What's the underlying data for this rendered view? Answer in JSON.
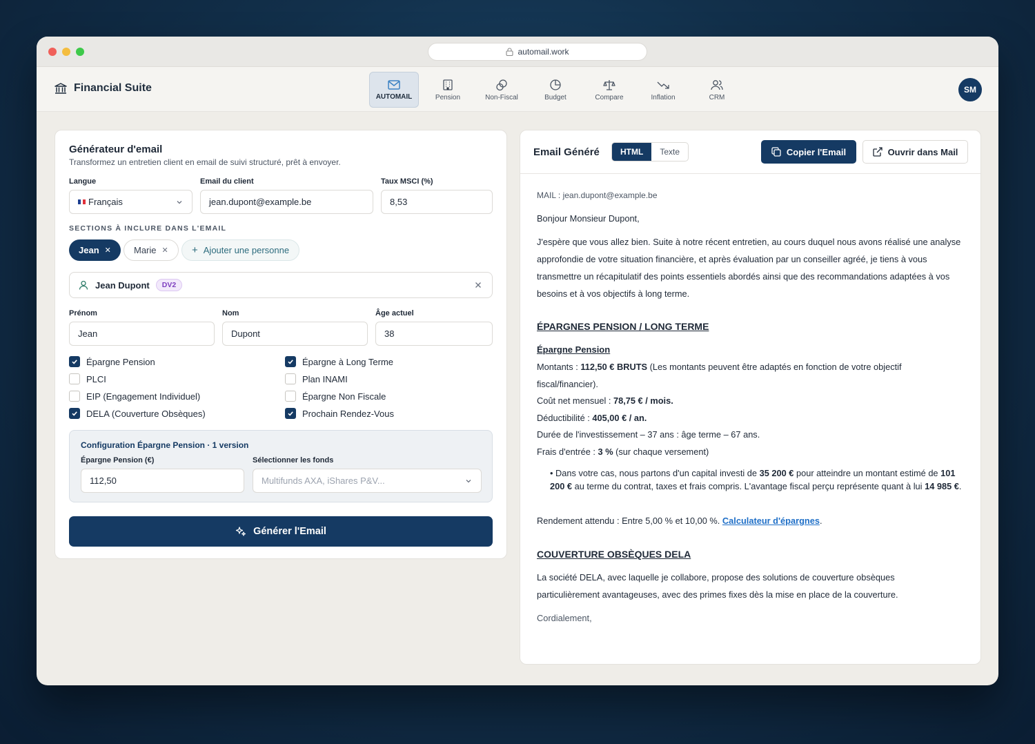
{
  "browser": {
    "url": "automail.work"
  },
  "header": {
    "brand": "Financial Suite",
    "avatar": "SM",
    "tabs": [
      {
        "label": "AUTOMAIL",
        "icon": "mail-icon"
      },
      {
        "label": "Pension",
        "icon": "building-icon"
      },
      {
        "label": "Non-Fiscal",
        "icon": "coins-icon"
      },
      {
        "label": "Budget",
        "icon": "pie-chart-icon"
      },
      {
        "label": "Compare",
        "icon": "scale-icon"
      },
      {
        "label": "Inflation",
        "icon": "trending-down-icon"
      },
      {
        "label": "CRM",
        "icon": "users-icon"
      }
    ]
  },
  "generator": {
    "title": "Générateur d'email",
    "subtitle": "Transformez un entretien client en email de suivi structuré, prêt à envoyer.",
    "langue_label": "Langue",
    "langue_value": "Français",
    "email_label": "Email du client",
    "email_value": "jean.dupont@example.be",
    "msci_label": "Taux MSCI (%)",
    "msci_value": "8,53",
    "sections_label": "SECTIONS À INCLURE DANS L'EMAIL",
    "persons": [
      "Jean",
      "Marie"
    ],
    "add_person": "Ajouter une personne",
    "person_card": {
      "name": "Jean Dupont",
      "badge": "DV2"
    },
    "prenom_label": "Prénom",
    "prenom_value": "Jean",
    "nom_label": "Nom",
    "nom_value": "Dupont",
    "age_label": "Âge actuel",
    "age_value": "38",
    "checkboxes": [
      {
        "label": "Épargne Pension",
        "checked": true
      },
      {
        "label": "Épargne à Long Terme",
        "checked": true
      },
      {
        "label": "PLCI",
        "checked": false
      },
      {
        "label": "Plan INAMI",
        "checked": false
      },
      {
        "label": "EIP (Engagement Individuel)",
        "checked": false
      },
      {
        "label": "Épargne Non Fiscale",
        "checked": false
      },
      {
        "label": "DELA (Couverture Obsèques)",
        "checked": true
      },
      {
        "label": "Prochain Rendez-Vous",
        "checked": true
      }
    ],
    "config": {
      "title": "Configuration Épargne Pension · 1 version",
      "amount_label": "Épargne Pension (€)",
      "amount_value": "112,50",
      "funds_label": "Sélectionner les fonds",
      "funds_placeholder": "Multifunds AXA, iShares P&V..."
    },
    "generate_button": "Générer l'Email"
  },
  "result": {
    "title": "Email Généré",
    "tab_html": "HTML",
    "tab_text": "Texte",
    "copy_button": "Copier l'Email",
    "open_mail_button": "Ouvrir dans Mail",
    "mail_line": "MAIL : jean.dupont@example.be",
    "greeting": "Bonjour Monsieur Dupont,",
    "intro": "J'espère que vous allez bien. Suite à notre récent entretien, au cours duquel nous avons réalisé une analyse approfondie de votre situation financière, et après évaluation par un conseiller agréé, je tiens à vous transmettre un récapitulatif des points essentiels abordés ainsi que des recommandations adaptées à vos besoins et à vos objectifs à long terme.",
    "section1_title": "ÉPARGNES PENSION / LONG TERME",
    "sub1_title": "Épargne Pension",
    "montants_prefix": "Montants : ",
    "montants_bold": "112,50 € BRUTS",
    "montants_suffix": " (Les montants peuvent être adaptés en fonction de votre objectif fiscal/financier).",
    "cout_prefix": "Coût net mensuel : ",
    "cout_bold": "78,75 € / mois.",
    "deduct_prefix": "Déductibilité : ",
    "deduct_bold": "405,00 € / an.",
    "duree": "Durée de l'investissement – 37 ans : âge terme – 67 ans.",
    "frais_prefix": "Frais d'entrée : ",
    "frais_bold": "3 %",
    "frais_suffix": " (sur chaque versement)",
    "bullet_1": "Dans votre cas, nous partons d'un capital investi de ",
    "bullet_b1": "35 200 €",
    "bullet_2": " pour atteindre un montant estimé de ",
    "bullet_b2": "101 200 €",
    "bullet_3": " au terme du contrat, taxes et frais compris. L'avantage fiscal perçu représente quant à lui ",
    "bullet_b3": "14 985 €",
    "bullet_4": ".",
    "rendement_prefix": "Rendement attendu : Entre 5,00 % et 10,00 %. ",
    "rendement_link": "Calculateur d'épargnes",
    "rendement_suffix": ".",
    "section2_title": "COUVERTURE OBSÈQUES DELA",
    "dela_text": "La société DELA, avec laquelle je collabore, propose des solutions de couverture obsèques particulièrement avantageuses, avec des primes fixes dès la mise en place de la couverture.",
    "closing": "Cordialement,"
  },
  "colors": {
    "primary": "#153a63",
    "link": "#1f6fc7",
    "badge": "#7e3fbf"
  }
}
